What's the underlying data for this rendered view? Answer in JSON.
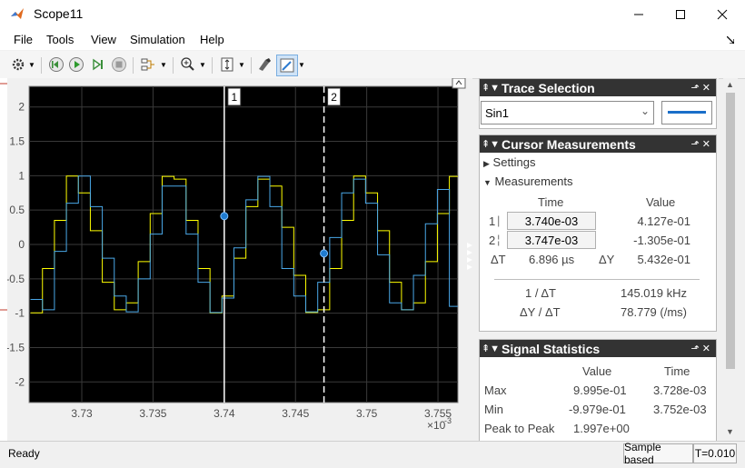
{
  "window": {
    "title": "Scope11"
  },
  "menu": [
    "File",
    "Tools",
    "View",
    "Simulation",
    "Help"
  ],
  "plot": {
    "y_ticks": [
      "2",
      "1.5",
      "1",
      "0.5",
      "0",
      "-0.5",
      "-1",
      "-1.5",
      "-2"
    ],
    "x_ticks": [
      "3.73",
      "3.735",
      "3.74",
      "3.745",
      "3.75",
      "3.755"
    ],
    "x_exponent": "×10",
    "x_exponent_power": "-3",
    "cursor1_label": "1",
    "cursor2_label": "2"
  },
  "chart_data": {
    "type": "line",
    "xlim": [
      0.0037263,
      0.0037564
    ],
    "ylim": [
      -2.3,
      2.3
    ],
    "grid": true,
    "cursors": [
      0.00374,
      0.003747
    ],
    "series": [
      {
        "color": "#ffff00",
        "x": [
          0.0037264,
          0.00372724,
          0.00372808,
          0.00372892,
          0.00372976,
          0.0037306,
          0.00373144,
          0.00373228,
          0.00373312,
          0.00373396,
          0.0037348,
          0.00373564,
          0.00373648,
          0.00373732,
          0.00373816,
          0.003739,
          0.00373984,
          0.00374068,
          0.00374152,
          0.00374236,
          0.0037432,
          0.00374404,
          0.00374488,
          0.00374572,
          0.00374656,
          0.0037474,
          0.00374824,
          0.00374908,
          0.00374992,
          0.00375076,
          0.0037516,
          0.00375244,
          0.00375328,
          0.00375412,
          0.00375496,
          0.0037558
        ],
        "y": [
          -0.995,
          -0.35,
          0.35,
          0.995,
          0.75,
          0.2,
          -0.55,
          -0.95,
          -0.85,
          -0.25,
          0.45,
          0.99,
          0.95,
          0.35,
          -0.35,
          -0.995,
          -0.75,
          -0.2,
          0.55,
          0.95,
          0.85,
          0.25,
          -0.45,
          -0.99,
          -0.95,
          -0.35,
          0.35,
          0.995,
          0.75,
          0.2,
          -0.55,
          -0.95,
          -0.85,
          -0.25,
          0.45,
          0.99
        ]
      },
      {
        "color": "#4aa8e8",
        "x": [
          0.0037264,
          0.00372724,
          0.00372808,
          0.00372892,
          0.00372976,
          0.0037306,
          0.00373144,
          0.00373228,
          0.00373312,
          0.00373396,
          0.0037348,
          0.00373564,
          0.00373648,
          0.00373732,
          0.00373816,
          0.003739,
          0.00373984,
          0.00374068,
          0.00374152,
          0.00374236,
          0.0037432,
          0.00374404,
          0.00374488,
          0.00374572,
          0.00374656,
          0.0037474,
          0.00374824,
          0.00374908,
          0.00374992,
          0.00375076,
          0.0037516,
          0.00375244,
          0.00375328,
          0.00375412,
          0.00375496,
          0.0037558
        ],
        "y": [
          -0.8,
          -0.95,
          -0.1,
          0.6,
          0.995,
          0.55,
          -0.2,
          -0.75,
          -0.98,
          -0.5,
          0.15,
          0.85,
          0.85,
          0.15,
          -0.55,
          -0.99,
          -0.78,
          -0.05,
          0.65,
          0.99,
          0.55,
          -0.35,
          -0.75,
          -0.98,
          -0.55,
          0.1,
          0.75,
          0.95,
          0.6,
          -0.15,
          -0.85,
          -0.95,
          -0.45,
          0.3,
          0.8,
          -0.9
        ]
      }
    ]
  },
  "trace_selection": {
    "header": "Trace Selection",
    "selected": "Sin1"
  },
  "cursor_measurements": {
    "header": "Cursor Measurements",
    "settings_label": "Settings",
    "measurements_label": "Measurements",
    "col_time": "Time",
    "col_value": "Value",
    "row1_label": "1",
    "row1_time": "3.740e-03",
    "row1_value": "4.127e-01",
    "row2_label": "2",
    "row2_time": "3.747e-03",
    "row2_value": "-1.305e-01",
    "dt_label": "ΔT",
    "dt_value": "6.896 µs",
    "dy_label": "ΔY",
    "dy_value": "5.432e-01",
    "inv_dt_label": "1 / ΔT",
    "inv_dt_value": "145.019 kHz",
    "dy_dt_label": "ΔY / ΔT",
    "dy_dt_value": "78.779 (/ms)"
  },
  "signal_statistics": {
    "header": "Signal Statistics",
    "col_value": "Value",
    "col_time": "Time",
    "rows": [
      {
        "label": "Max",
        "value": "9.995e-01",
        "time": "3.728e-03"
      },
      {
        "label": "Min",
        "value": "-9.979e-01",
        "time": "3.752e-03"
      },
      {
        "label": "Peak to Peak",
        "value": "1.997e+00",
        "time": ""
      }
    ]
  },
  "status": {
    "left": "Ready",
    "mode": "Sample based",
    "time": "T=0.010"
  }
}
